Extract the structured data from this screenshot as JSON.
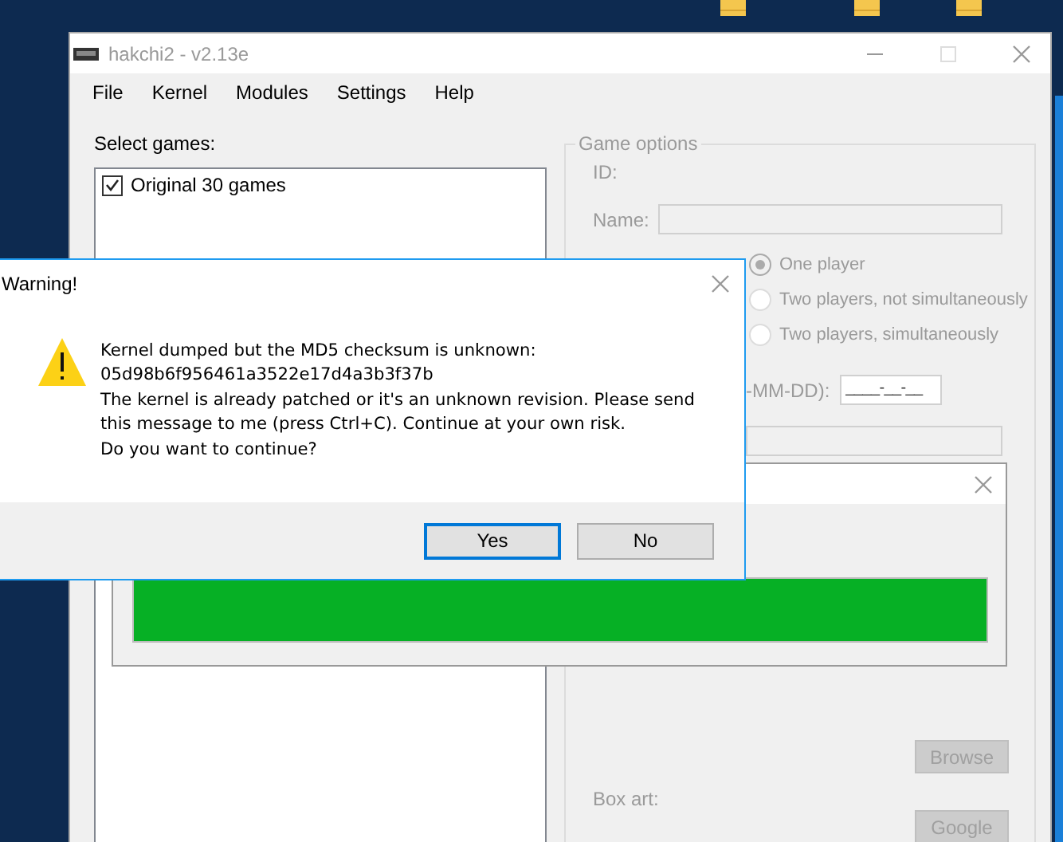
{
  "main_window": {
    "title": "hakchi2 - v2.13e",
    "menu": [
      "File",
      "Kernel",
      "Modules",
      "Settings",
      "Help"
    ],
    "games_label": "Select games:",
    "games": [
      {
        "label": "Original 30 games",
        "checked": true
      }
    ],
    "game_options": {
      "title": "Game options",
      "disabled": true,
      "id_label": "ID:",
      "name_label": "Name:",
      "players": [
        {
          "label": "One player",
          "selected": true
        },
        {
          "label": "Two players, not simultaneously",
          "selected": false
        },
        {
          "label": "Two players, simultaneously",
          "selected": false
        }
      ],
      "date_label": "-MM-DD):",
      "date_value": "____-__-__",
      "box_art_label": "Box art:",
      "buttons": [
        {
          "label": "Browse",
          "disabled": true
        },
        {
          "label": "Google",
          "disabled": true
        }
      ]
    }
  },
  "progress_window": {
    "level": 1
  },
  "dialog": {
    "title": "Warning!",
    "message": [
      "Kernel dumped but the MD5 checksum is unknown:",
      "05d98b6f956461a3522e17d4a3b3f37b",
      "The kernel is already patched or it's an unknown revision. Please send",
      "this message to me (press Ctrl+C). Continue at your own risk.",
      "Do you want to continue?"
    ],
    "buttons": [
      {
        "label": "Yes",
        "focused": true
      },
      {
        "label": "No",
        "focused": false
      }
    ]
  }
}
